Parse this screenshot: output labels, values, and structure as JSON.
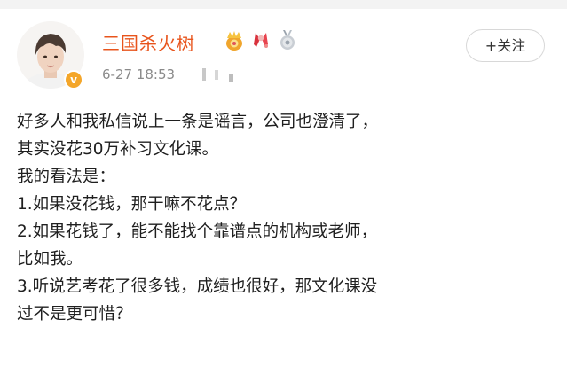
{
  "post": {
    "author": {
      "name": "三国杀火树",
      "verified_badge": "v"
    },
    "badges": [
      "crown-badge-icon",
      "red-ribbon-badge-icon",
      "silver-medal-badge-icon"
    ],
    "timestamp": "6-27 18:53",
    "follow_label": "+关注",
    "content_lines": [
      "好多人和我私信说上一条是谣言，公司也澄清了，",
      "其实没花30万补习文化课。",
      "我的看法是：",
      "1.如果没花钱，那干嘛不花点？",
      "2.如果花钱了，能不能找个靠谱点的机构或老师，",
      "比如我。",
      "3.听说艺考花了很多钱，成绩也很好，那文化课没",
      "过不是更可惜？"
    ],
    "colors": {
      "username": "#e8541c",
      "timestamp": "#8a8a8a",
      "text": "#1f1f1f",
      "verified": "#f4a62a"
    }
  }
}
